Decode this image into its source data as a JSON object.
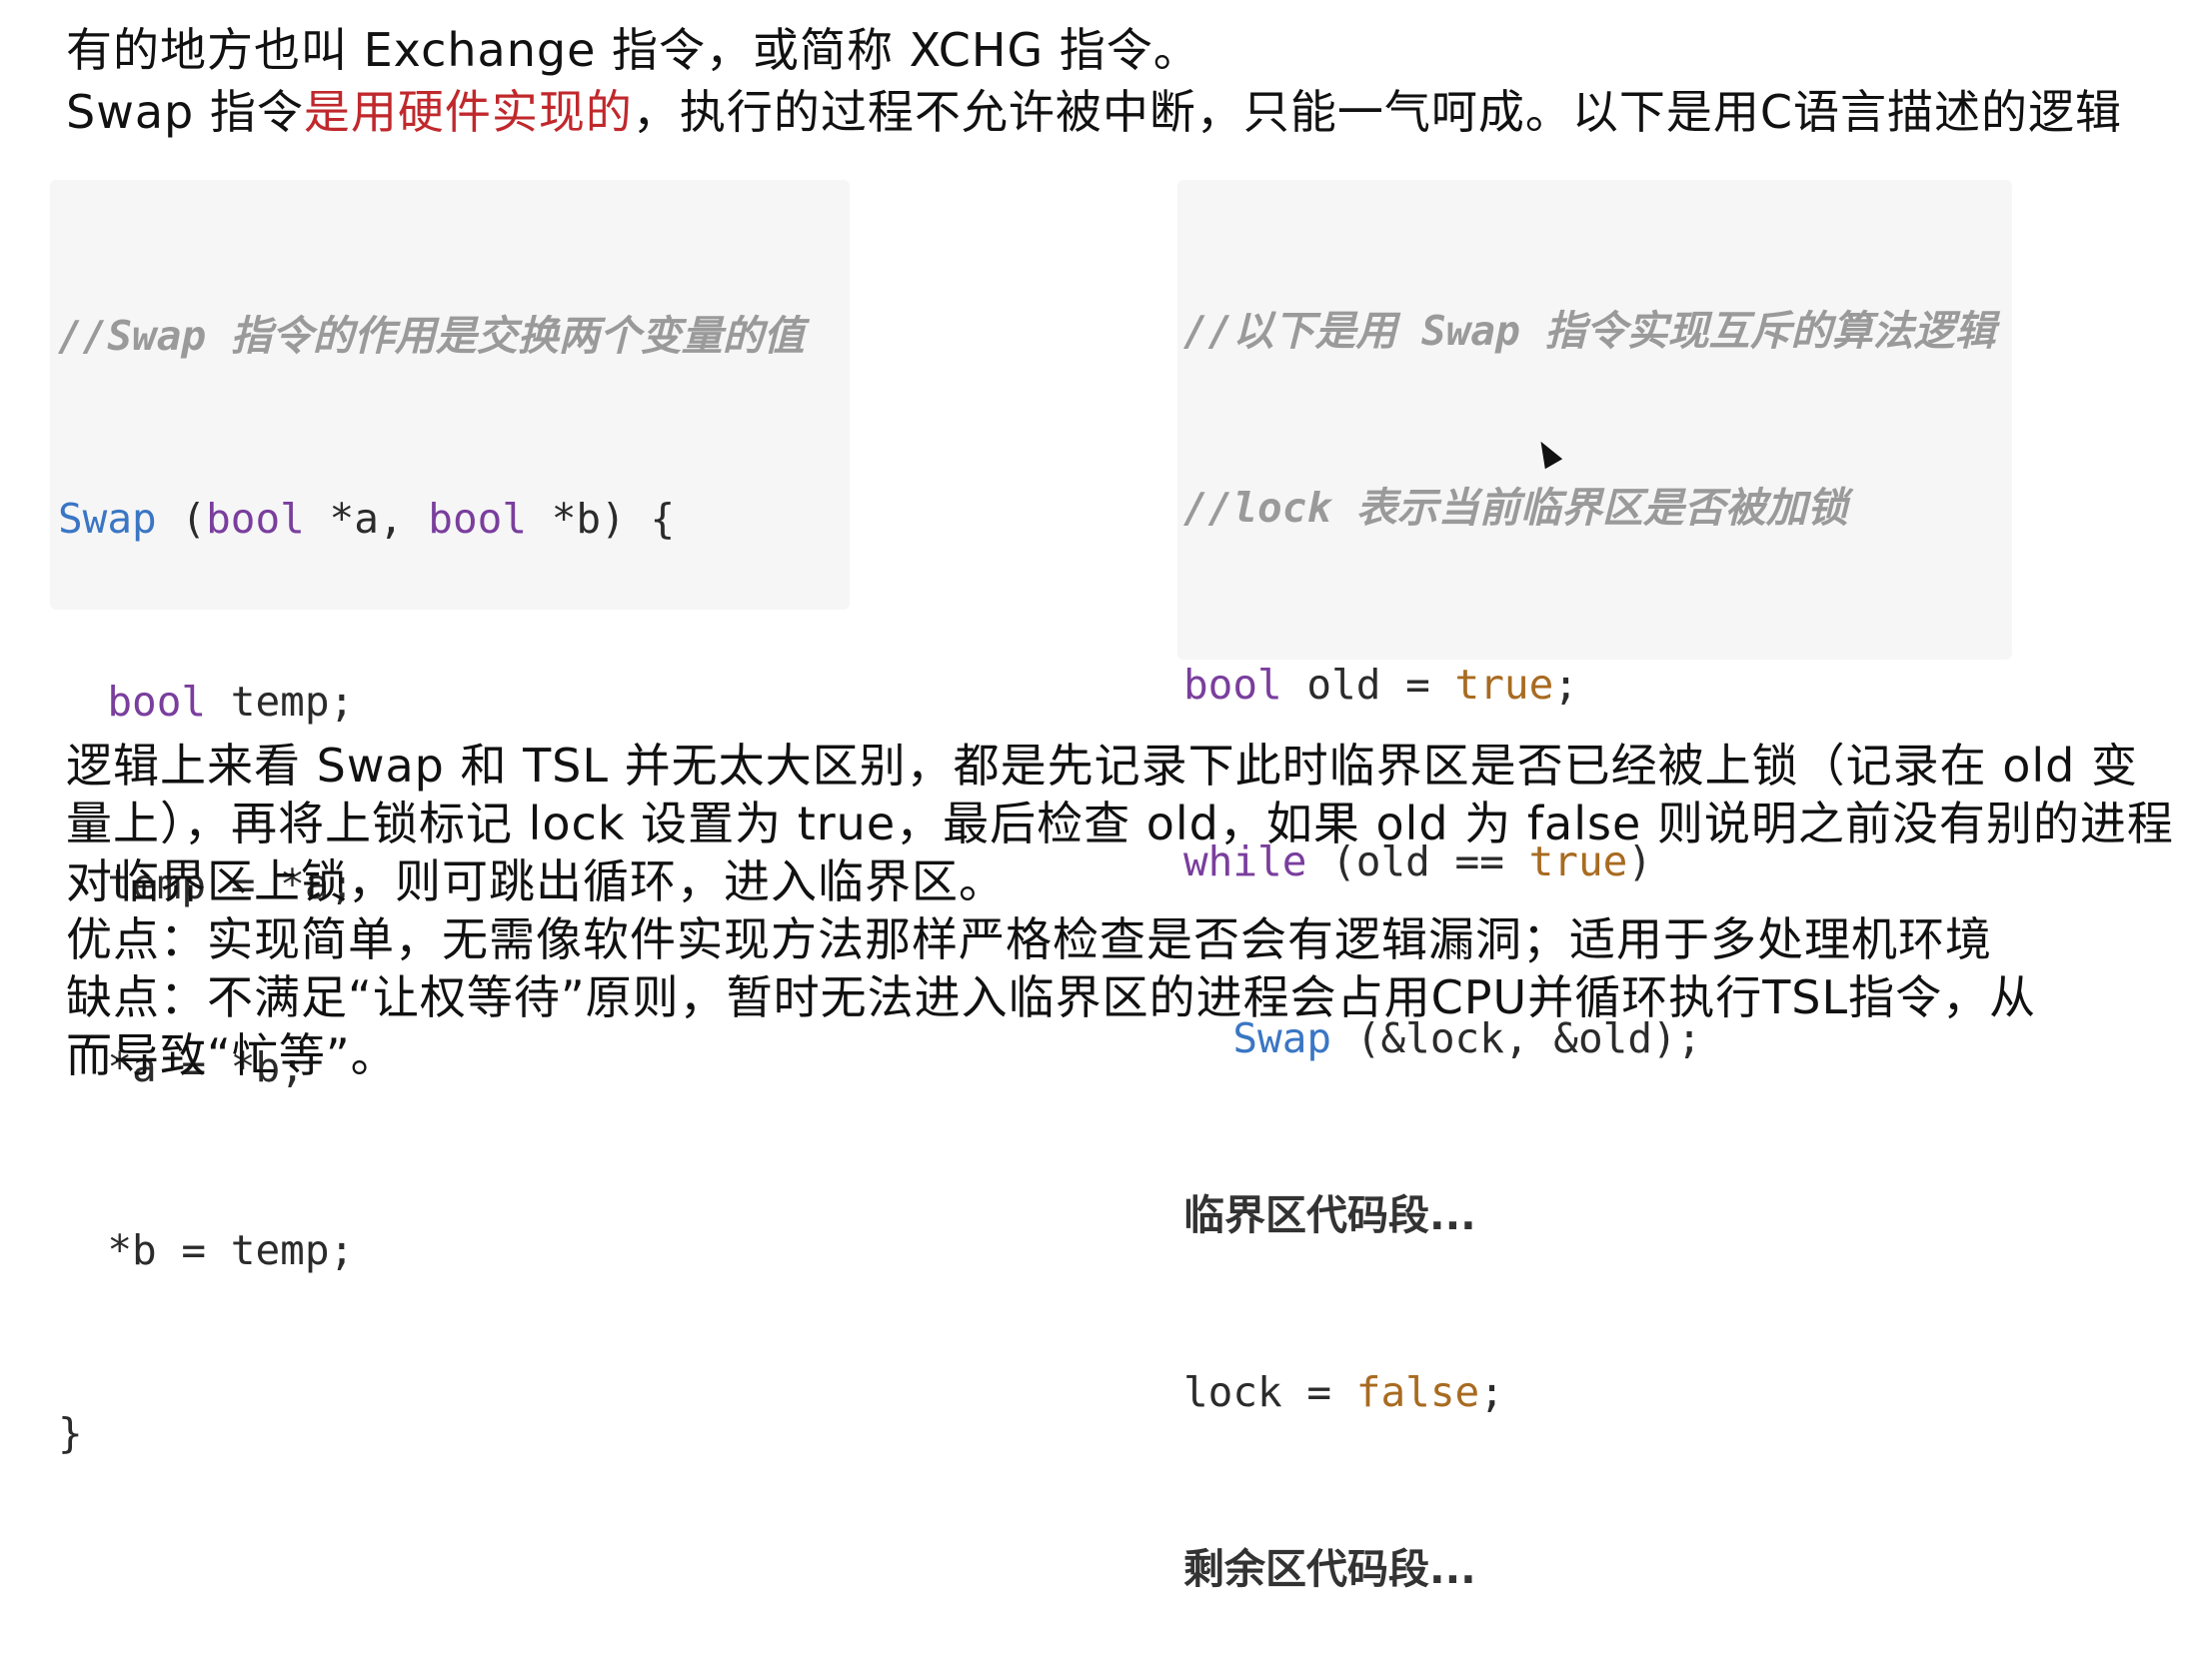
{
  "intro": {
    "line1": "有的地方也叫 Exchange 指令，或简称 XCHG 指令。",
    "line2_prefix": "Swap 指令",
    "line2_highlight": "是用硬件实现的",
    "line2_suffix": "，执行的过程不允许被中断，只能一气呵成。以下是用C语言描述的逻辑"
  },
  "left_code": {
    "comment": "//Swap 指令的作用是交换两个变量的值",
    "l1_fn": "Swap",
    "l1_a": " (",
    "l1_kw1": "bool",
    "l1_b": " *a, ",
    "l1_kw2": "bool",
    "l1_c": " *b) {",
    "l2_indent": "  ",
    "l2_kw": "bool",
    "l2_rest": " temp;",
    "l3": "  temp = *a;",
    "l4": "  *a = *b;",
    "l5": "  *b = temp;",
    "l6": "}"
  },
  "right_code": {
    "comment1": "//以下是用 Swap 指令实现互斥的算法逻辑",
    "comment2": "//lock 表示当前临界区是否被加锁",
    "l1_kw": "bool",
    "l1_mid": " old = ",
    "l1_lit": "true",
    "l1_end": ";",
    "l2_kw": "while",
    "l2_mid": " (old == ",
    "l2_lit": "true",
    "l2_end": ")",
    "l3_indent": "  ",
    "l3_fn": "Swap",
    "l3_rest": " (&lock, &old);",
    "l4": "临界区代码段...",
    "l5_a": "lock = ",
    "l5_lit": "false",
    "l5_end": ";",
    "l6": "剩余区代码段..."
  },
  "explanation": {
    "line1": "逻辑上来看 Swap 和 TSL 并无太大区别，都是先记录下此时临界区是否已经被上锁（记录在 old 变",
    "line2": "量上），再将上锁标记 lock 设置为 true，最后检查 old，如果 old 为 false 则说明之前没有别的进程",
    "line3": "对临界区上锁，则可跳出循环，进入临界区。",
    "pros": "优点：实现简单，无需像软件实现方法那样严格检查是否会有逻辑漏洞；适用于多处理机环境",
    "cons1": "缺点：不满足“让权等待”原则，暂时无法进入临界区的进程会占用CPU并循环执行TSL指令，从",
    "cons2": "而导致“忙等”。"
  },
  "colors": {
    "highlight_red": "#c0282c",
    "keyword_purple": "#7a3e9d",
    "function_blue": "#3a76c4",
    "literal_orange": "#a86b21",
    "comment_gray": "#9a9a9a"
  }
}
